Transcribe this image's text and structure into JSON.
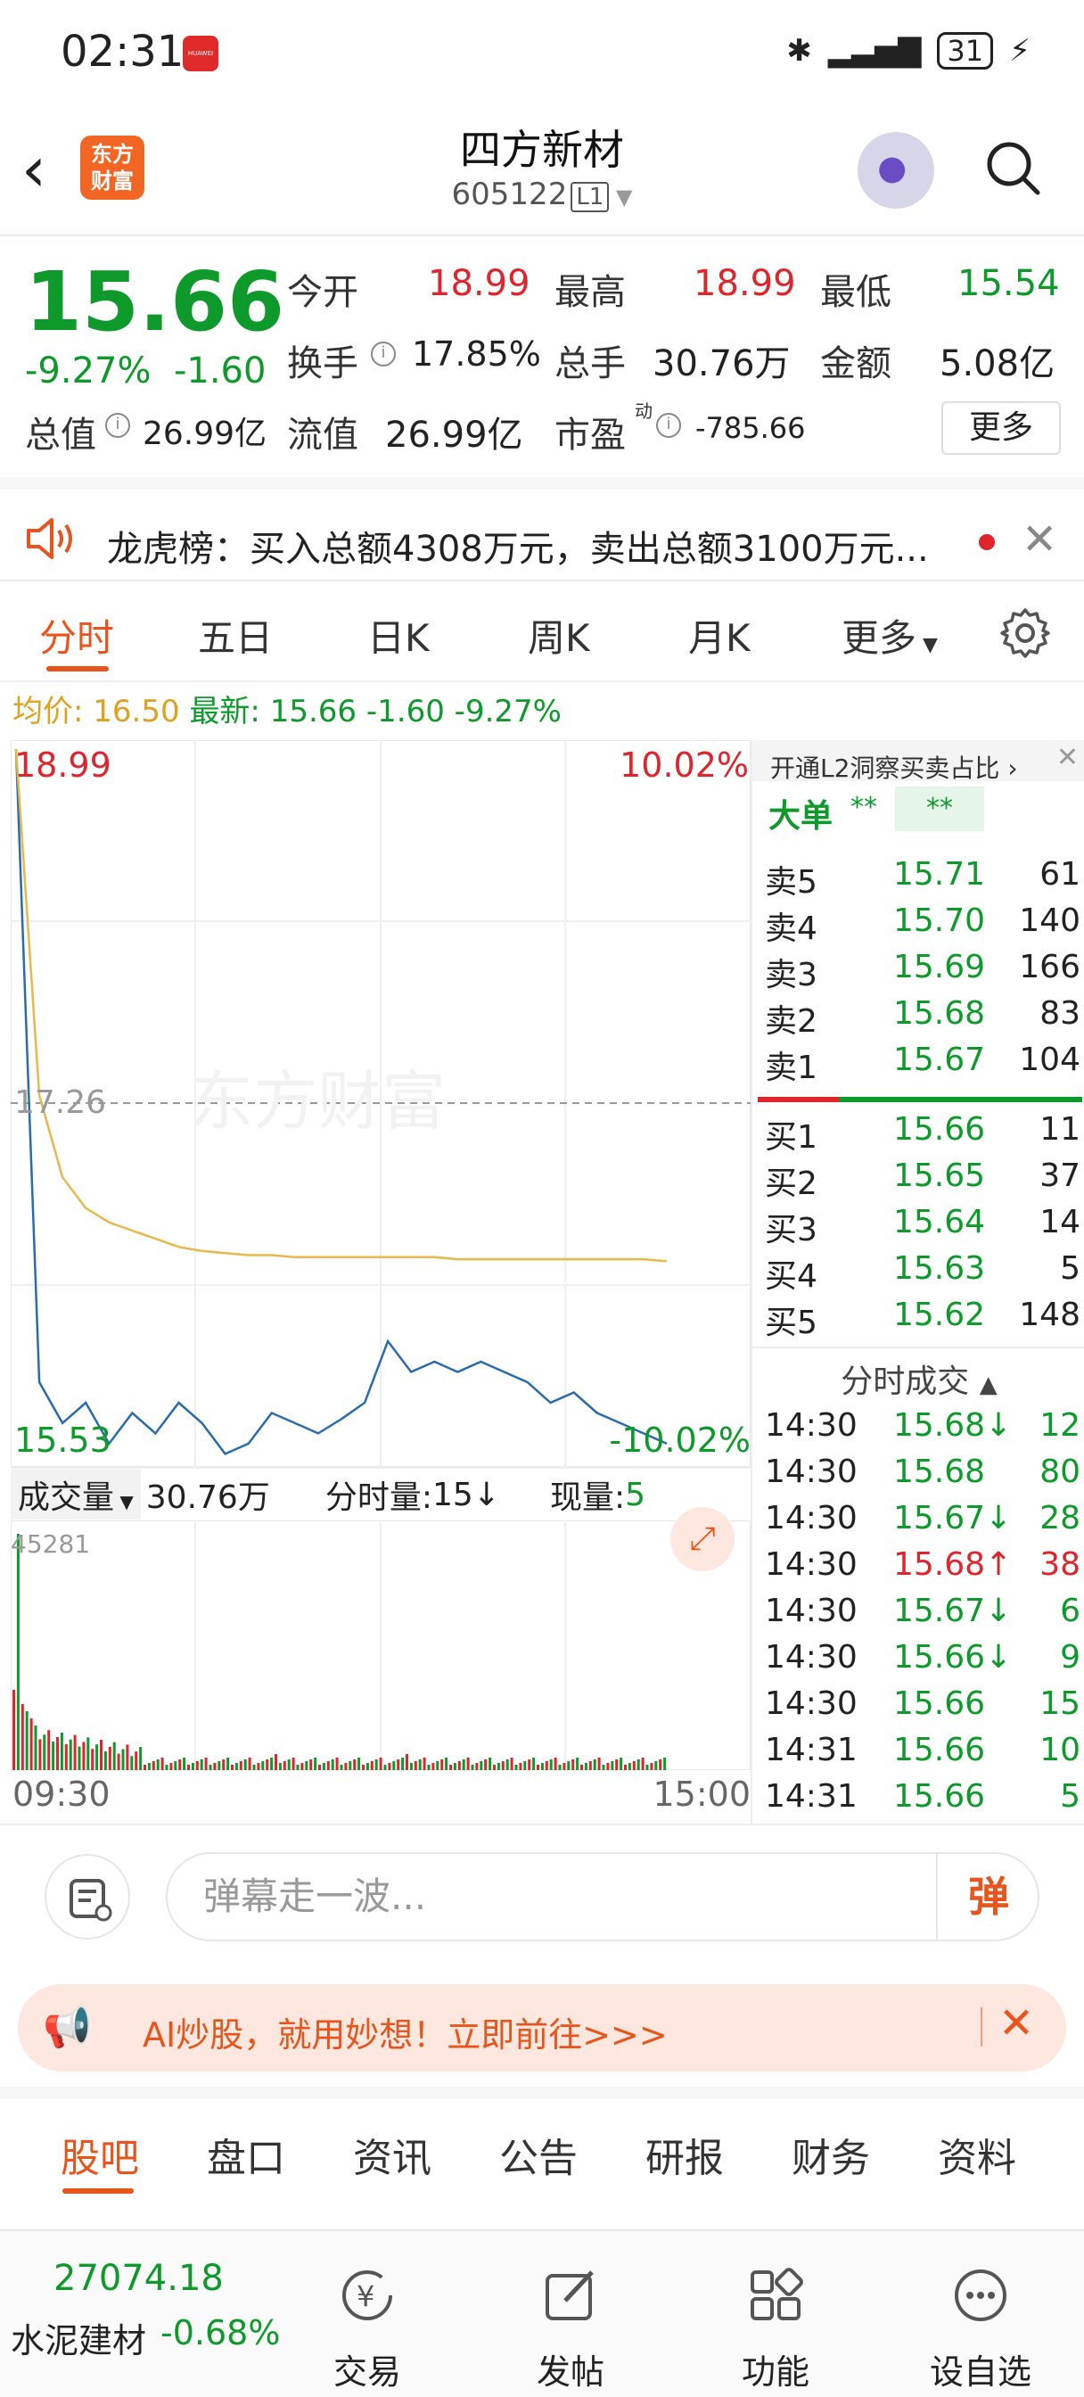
{
  "status_bar": {
    "time": "02:31",
    "battery": "31"
  },
  "header": {
    "title": "四方新材",
    "code": "605122",
    "level": "L1"
  },
  "quote": {
    "price": "15.66",
    "change_pct": "-9.27%",
    "change": "-1.60",
    "open_label": "今开",
    "open": "18.99",
    "high_label": "最高",
    "high": "18.99",
    "low_label": "最低",
    "low": "15.54",
    "turnover_label": "换手",
    "turnover": "17.85%",
    "volume_label": "总手",
    "volume": "30.76万",
    "amount_label": "金额",
    "amount": "5.08亿",
    "mktcap_label": "总值",
    "mktcap": "26.99亿",
    "float_label": "流值",
    "float_cap": "26.99亿",
    "pe_label": "市盈",
    "pe_sup": "动",
    "pe": "-785.66",
    "more_label": "更多"
  },
  "notice": {
    "text": "龙虎榜：买入总额4308万元，卖出总额3100万元..."
  },
  "tabs": [
    "分时",
    "五日",
    "日K",
    "周K",
    "月K",
    "更多"
  ],
  "avg": {
    "avg_label": "均价:",
    "avg": "16.50",
    "last_label": "最新:",
    "last": "15.66",
    "chg": "-1.60",
    "pct": "-9.27%"
  },
  "chart_data": {
    "type": "line",
    "title": "",
    "xlabel": "",
    "ylabel": "",
    "x_ticks": [
      "09:30",
      "15:00"
    ],
    "y_top": "18.99",
    "y_mid": "17.26",
    "y_bottom": "15.53",
    "pct_top": "10.02%",
    "pct_bottom": "-10.02%",
    "ylim": [
      15.53,
      18.99
    ],
    "watermark": "东方财富",
    "series": [
      {
        "values": [
          18.99,
          15.9,
          15.7,
          15.8,
          15.6,
          15.75,
          15.65,
          15.8,
          15.7,
          15.55,
          15.6,
          15.75,
          15.7,
          15.65,
          15.72,
          15.8,
          16.1,
          15.95,
          16.0,
          15.95,
          16.0,
          15.95,
          15.9,
          15.8,
          15.85,
          15.75,
          15.7,
          15.65,
          15.6
        ]
      },
      {
        "values": [
          18.99,
          17.3,
          16.9,
          16.75,
          16.68,
          16.64,
          16.6,
          16.56,
          16.54,
          16.53,
          16.52,
          16.52,
          16.51,
          16.51,
          16.51,
          16.51,
          16.51,
          16.51,
          16.51,
          16.5,
          16.5,
          16.5,
          16.5,
          16.5,
          16.5,
          16.5,
          16.5,
          16.5,
          16.49
        ]
      }
    ]
  },
  "volume": {
    "label": "成交量",
    "total": "30.76万",
    "fen_label": "分时量:",
    "fen_value": "15↓",
    "now_label": "现量:",
    "now_value": "5",
    "max": "45281",
    "x_start": "09:30",
    "x_end": "15:00"
  },
  "orderbook": {
    "promo": "开通L2洞察买卖占比",
    "big_label": "大单",
    "big_v1": "**",
    "big_v2": "**",
    "asks": [
      {
        "label": "卖5",
        "price": "15.71",
        "vol": "61"
      },
      {
        "label": "卖4",
        "price": "15.70",
        "vol": "140"
      },
      {
        "label": "卖3",
        "price": "15.69",
        "vol": "166"
      },
      {
        "label": "卖2",
        "price": "15.68",
        "vol": "83"
      },
      {
        "label": "卖1",
        "price": "15.67",
        "vol": "104"
      }
    ],
    "bids": [
      {
        "label": "买1",
        "price": "15.66",
        "vol": "11"
      },
      {
        "label": "买2",
        "price": "15.65",
        "vol": "37"
      },
      {
        "label": "买3",
        "price": "15.64",
        "vol": "14"
      },
      {
        "label": "买4",
        "price": "15.63",
        "vol": "5"
      },
      {
        "label": "买5",
        "price": "15.62",
        "vol": "148"
      }
    ],
    "trades_label": "分时成交",
    "trades": [
      {
        "time": "14:30",
        "price": "15.68↓",
        "vol": "12",
        "dir": "down"
      },
      {
        "time": "14:30",
        "price": "15.68",
        "vol": "80",
        "dir": "none"
      },
      {
        "time": "14:30",
        "price": "15.67↓",
        "vol": "28",
        "dir": "down"
      },
      {
        "time": "14:30",
        "price": "15.68↑",
        "vol": "38",
        "dir": "up"
      },
      {
        "time": "14:30",
        "price": "15.67↓",
        "vol": "6",
        "dir": "down"
      },
      {
        "time": "14:30",
        "price": "15.66↓",
        "vol": "9",
        "dir": "down"
      },
      {
        "time": "14:30",
        "price": "15.66",
        "vol": "15",
        "dir": "none"
      },
      {
        "time": "14:31",
        "price": "15.66",
        "vol": "10",
        "dir": "none"
      },
      {
        "time": "14:31",
        "price": "15.66",
        "vol": "5",
        "dir": "none"
      }
    ]
  },
  "danmu": {
    "placeholder": "弹幕走一波...",
    "send": "弹"
  },
  "ai_bar": {
    "text": "AI炒股，就用妙想！立即前往>>>"
  },
  "bottom_tabs": [
    "股吧",
    "盘口",
    "资讯",
    "公告",
    "研报",
    "财务",
    "资料"
  ],
  "nav": {
    "index_value": "27074.18",
    "index_name": "水泥建材",
    "index_pct": "-0.68%",
    "items": [
      "交易",
      "发帖",
      "功能",
      "设自选"
    ]
  }
}
